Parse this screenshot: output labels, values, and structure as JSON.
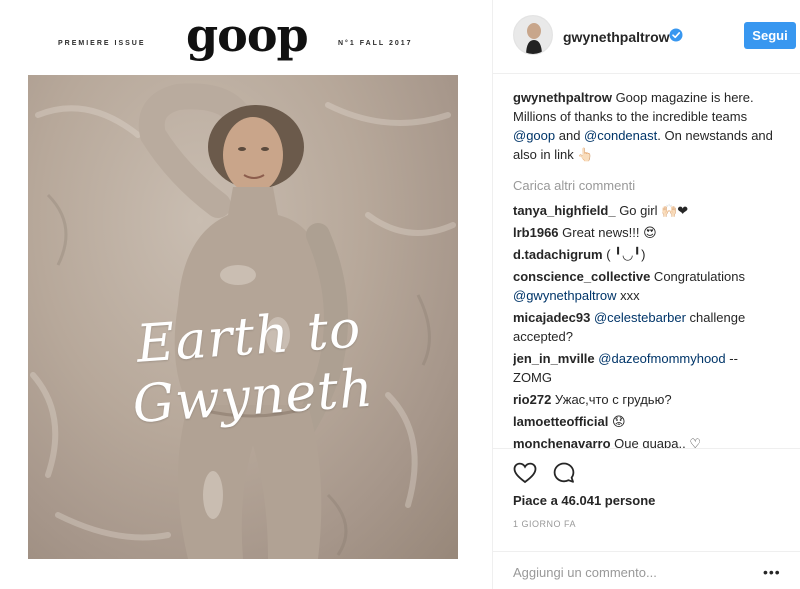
{
  "magazine": {
    "premiere_label": "PREMIERE ISSUE",
    "logo": "goop",
    "issue_label": "N°1 FALL 2017",
    "cover_script": "Earth to Gwyneth"
  },
  "post": {
    "username": "gwynethpaltrow",
    "verified": true,
    "follow_label": "Segui",
    "caption": {
      "user": "gwynethpaltrow",
      "text_1": " Goop magazine is here. Millions of thanks to the incredible teams ",
      "mention_1": "@goop",
      "text_2": " and ",
      "mention_2": "@condenast",
      "text_3": ". On newstands and also in link ",
      "emoji": "👆🏻"
    },
    "load_more_label": "Carica altri commenti",
    "comments": [
      {
        "user": "tanya_highfield_",
        "pre": " Go girl ",
        "mention": "",
        "post": "🙌🏻❤"
      },
      {
        "user": "lrb1966",
        "pre": " Great news!!! ",
        "mention": "",
        "post": "😍"
      },
      {
        "user": "d.tadachigrum",
        "pre": "  ( ╹◡╹)",
        "mention": "",
        "post": ""
      },
      {
        "user": "conscience_collective",
        "pre": " Congratulations ",
        "mention": "@gwynethpaltrow",
        "post": " xxx"
      },
      {
        "user": "micajadec93",
        "pre": " ",
        "mention": "@celestebarber",
        "post": " challenge accepted?"
      },
      {
        "user": "jen_in_mville",
        "pre": " ",
        "mention": "@dazeofmommyhood",
        "post": " -- ZOMG"
      },
      {
        "user": "rio272",
        "pre": " Ужас,что с грудью?",
        "mention": "",
        "post": ""
      },
      {
        "user": "lamoetteofficial",
        "pre": " ",
        "mention": "",
        "post": "😟"
      },
      {
        "user": "monchenavarro",
        "pre": " Que guapa.. ",
        "mention": "",
        "post": "♡"
      }
    ],
    "likes_label": "Piace a 46.041 persone",
    "date_label": "1 GIORNO FA",
    "add_comment_placeholder": "Aggiungi un commento...",
    "more_dots": "•••"
  },
  "icons": {
    "heart": "heart-icon",
    "comment": "comment-icon",
    "verified": "verified-badge-icon",
    "more": "more-options-icon"
  },
  "colors": {
    "accent": "#3897f0",
    "mention": "#003569",
    "muted": "#999999",
    "text": "#262626"
  }
}
